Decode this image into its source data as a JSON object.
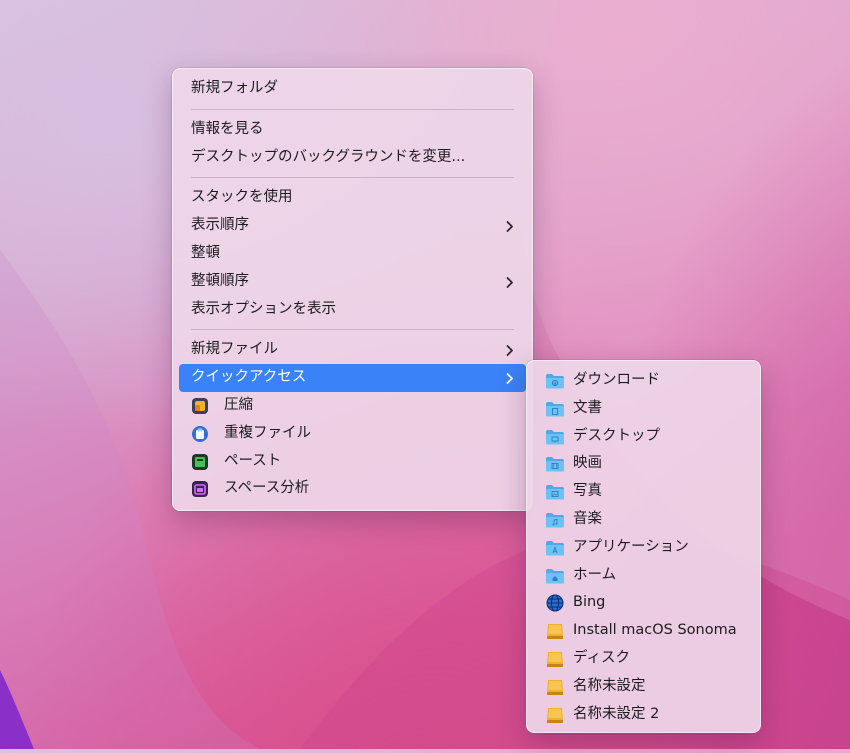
{
  "main_menu": {
    "new_folder": "新規フォルダ",
    "get_info": "情報を見る",
    "change_background": "デスクトップのバックグラウンドを変更...",
    "use_stacks": "スタックを使用",
    "sort_by": "表示順序",
    "clean_up": "整頓",
    "clean_up_by": "整頓順序",
    "show_view_options": "表示オプションを表示",
    "new_file": "新規ファイル",
    "quick_access": "クイックアクセス",
    "compress": "圧縮",
    "duplicate_files": "重複ファイル",
    "paste": "ペースト",
    "space_analysis": "スペース分析"
  },
  "sub_menu": {
    "items": [
      {
        "label": "ダウンロード",
        "icon": "downloads-folder-icon"
      },
      {
        "label": "文書",
        "icon": "documents-folder-icon"
      },
      {
        "label": "デスクトップ",
        "icon": "desktop-folder-icon"
      },
      {
        "label": "映画",
        "icon": "movies-folder-icon"
      },
      {
        "label": "写真",
        "icon": "pictures-folder-icon"
      },
      {
        "label": "音楽",
        "icon": "music-folder-icon"
      },
      {
        "label": "アプリケーション",
        "icon": "applications-folder-icon"
      },
      {
        "label": "ホーム",
        "icon": "home-folder-icon"
      },
      {
        "label": "Bing",
        "icon": "globe-icon"
      },
      {
        "label": "Install macOS Sonoma",
        "icon": "disk-icon"
      },
      {
        "label": "ディスク",
        "icon": "disk-icon"
      },
      {
        "label": "名称未設定",
        "icon": "disk-icon"
      },
      {
        "label": "名称未設定 2",
        "icon": "disk-icon"
      }
    ]
  },
  "colors": {
    "highlight": "#3a82f7",
    "folder_blue": "#5fb8f0",
    "disk_gold": "#e8a21a"
  }
}
